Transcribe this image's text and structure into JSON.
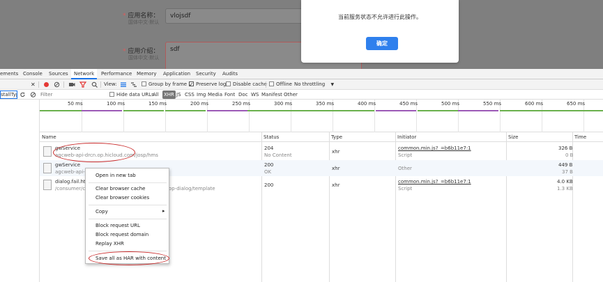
{
  "app": {
    "name_label": "应用名称：",
    "name_hint": "国体中文·默认",
    "name_value": "vlojsdf",
    "intro_label": "应用介绍：",
    "intro_hint": "国体中文·默认",
    "intro_value": "sdf",
    "required_mark": "*"
  },
  "dialog": {
    "message": "当前服务状态不允许进行此操作。",
    "ok_label": "确定"
  },
  "devtools": {
    "tabs": [
      "ements",
      "Console",
      "Sources",
      "Network",
      "Performance",
      "Memory",
      "Application",
      "Security",
      "Audits"
    ],
    "close_glyph": "✕",
    "toolbar": {
      "view_label": "View:",
      "group_by_frame": "Group by frame",
      "preserve_log": "Preserve log",
      "disable_cache": "Disable cache",
      "offline": "Offline",
      "throttling": "No throttling"
    },
    "left_input_value": "stallType",
    "filter": {
      "placeholder": "Filter",
      "hide_data_urls": "Hide data URLs",
      "types": [
        "All",
        "XHR",
        "JS",
        "CSS",
        "Img",
        "Media",
        "Font",
        "Doc",
        "WS",
        "Manifest",
        "Other"
      ],
      "selected": "XHR"
    },
    "ticks": [
      "50 ms",
      "100 ms",
      "150 ms",
      "200 ms",
      "250 ms",
      "300 ms",
      "350 ms",
      "400 ms",
      "450 ms",
      "500 ms",
      "550 ms",
      "600 ms",
      "650 ms"
    ],
    "columns": [
      "Name",
      "Status",
      "Type",
      "Initiator",
      "Size",
      "Time"
    ],
    "rows": [
      {
        "name": "gwService",
        "path": "agcweb-api-drcn.op.hicloud.com/josp/hms",
        "status": "204",
        "status_text": "No Content",
        "type": "xhr",
        "initiator": "common.min.js?_=b6b11e7:1",
        "initiator_sub": "Script",
        "size": "326 B",
        "size_sub": "0 B"
      },
      {
        "name": "gwService",
        "path": "agcweb-api-dr",
        "status": "200",
        "status_text": "OK",
        "type": "xhr",
        "initiator": "Other",
        "initiator_sub": "",
        "size": "449 B",
        "size_sub": "37 B"
      },
      {
        "name": "dialog.fail.html",
        "path": "/consumer/cn/",
        "path_tail": "op-dialog/template",
        "status": "200",
        "status_text": "",
        "type": "xhr",
        "initiator": "common.min.js?_=b6b11e7:1",
        "initiator_sub": "Script",
        "size": "4.0 KB",
        "size_sub": "1.3 KB"
      }
    ],
    "context_menu": {
      "open_new_tab": "Open in new tab",
      "clear_cache": "Clear browser cache",
      "clear_cookies": "Clear browser cookies",
      "copy": "Copy",
      "copy_arrow": "▸",
      "block_url": "Block request URL",
      "block_domain": "Block request domain",
      "replay_xhr": "Replay XHR",
      "save_har": "Save all as HAR with content"
    }
  },
  "colors": {
    "accent": "#1a73e8",
    "record": "#e53935",
    "dialog_button": "#2f80ed",
    "annotation": "#c82828"
  },
  "icons": [
    "record-icon",
    "clear-icon",
    "camera-icon",
    "filter-icon",
    "search-icon",
    "refresh-icon",
    "block-icon",
    "close-icon",
    "dropdown-arrow-icon"
  ]
}
